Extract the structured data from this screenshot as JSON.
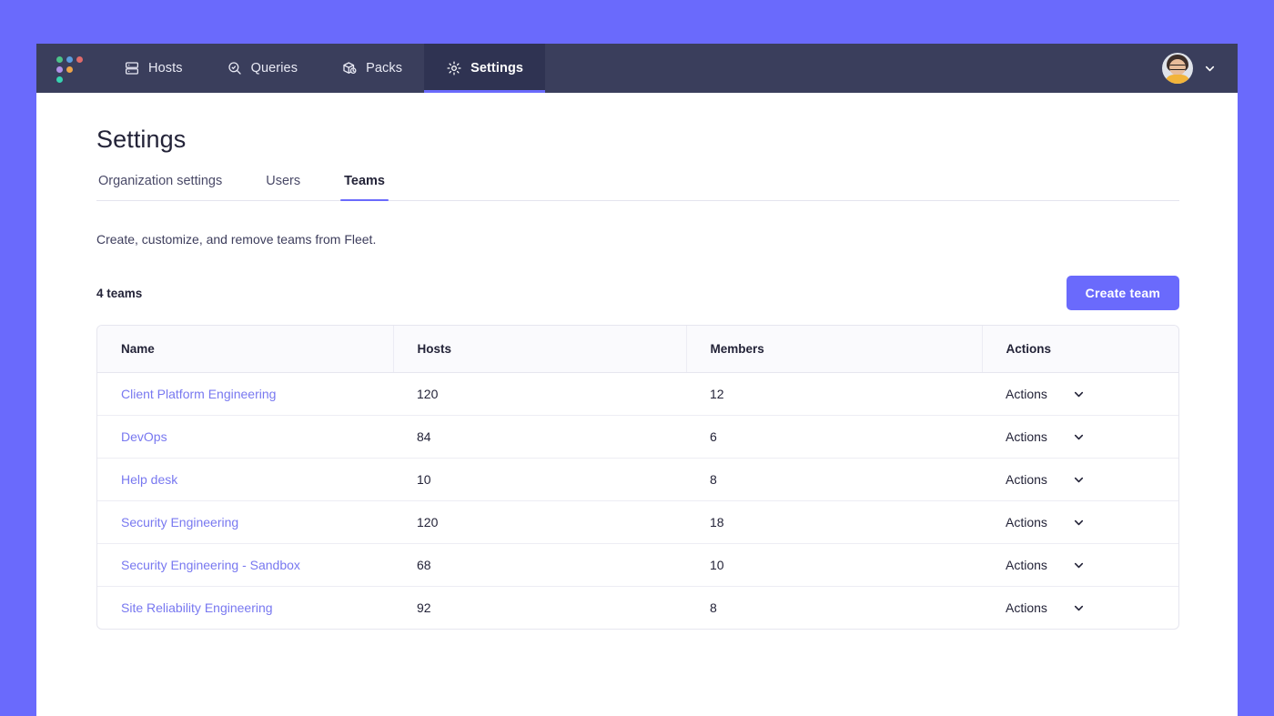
{
  "theme": {
    "page_background": "#6a6afc",
    "nav_background": "#3a3e5c",
    "nav_active_background": "#2f3352",
    "accent": "#6a6afc",
    "link": "#7878f0",
    "text": "#232338"
  },
  "topnav": {
    "logo": {
      "name": "fleet-logo",
      "dots": [
        {
          "color": "#4cc38a"
        },
        {
          "color": "#5b9dde"
        },
        {
          "color": "#e06b6b"
        },
        {
          "color": "#b292e8"
        },
        {
          "color": "#eda44a"
        },
        {
          "color": "#37d3b0"
        }
      ]
    },
    "items": [
      {
        "label": "Hosts",
        "icon": "server-icon",
        "active": false
      },
      {
        "label": "Queries",
        "icon": "search-check-icon",
        "active": false
      },
      {
        "label": "Packs",
        "icon": "package-clock-icon",
        "active": false
      },
      {
        "label": "Settings",
        "icon": "gear-icon",
        "active": true
      }
    ],
    "user_menu": {
      "avatar": "user-avatar",
      "chevron": "chevron-down-icon"
    }
  },
  "page": {
    "title": "Settings",
    "tabs": [
      {
        "label": "Organization settings",
        "active": false
      },
      {
        "label": "Users",
        "active": false
      },
      {
        "label": "Teams",
        "active": true
      }
    ],
    "subtitle": "Create, customize, and remove teams from Fleet.",
    "team_count_label": "4 teams",
    "create_button_label": "Create team"
  },
  "table": {
    "columns": [
      "Name",
      "Hosts",
      "Members",
      "Actions"
    ],
    "action_label": "Actions",
    "rows": [
      {
        "name": "Client Platform Engineering",
        "hosts": "120",
        "members": "12"
      },
      {
        "name": "DevOps",
        "hosts": "84",
        "members": "6"
      },
      {
        "name": "Help desk",
        "hosts": "10",
        "members": "8"
      },
      {
        "name": "Security Engineering",
        "hosts": "120",
        "members": "18"
      },
      {
        "name": "Security Engineering - Sandbox",
        "hosts": "68",
        "members": "10"
      },
      {
        "name": "Site Reliability Engineering",
        "hosts": "92",
        "members": "8"
      }
    ]
  }
}
